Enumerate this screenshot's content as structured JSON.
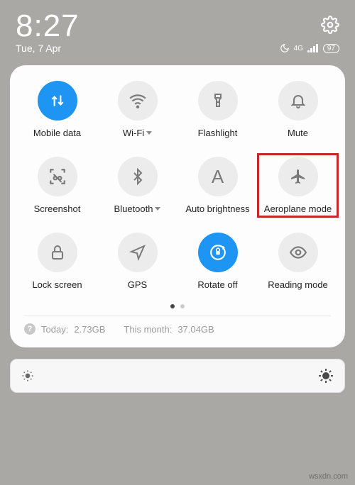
{
  "status": {
    "time": "8:27",
    "date": "Tue, 7 Apr",
    "network_label": "4G",
    "battery_label": "97"
  },
  "tiles": {
    "mobile_data": "Mobile data",
    "wifi": "Wi-Fi",
    "flashlight": "Flashlight",
    "mute": "Mute",
    "screenshot": "Screenshot",
    "bluetooth": "Bluetooth",
    "auto_brightness": "Auto brightness",
    "aeroplane_mode": "Aeroplane mode",
    "lock_screen": "Lock screen",
    "gps": "GPS",
    "rotate_off": "Rotate off",
    "reading_mode": "Reading mode"
  },
  "usage": {
    "today_label": "Today:",
    "today_value": "2.73GB",
    "month_label": "This month:",
    "month_value": "37.04GB"
  },
  "watermark": "wsxdn.com"
}
